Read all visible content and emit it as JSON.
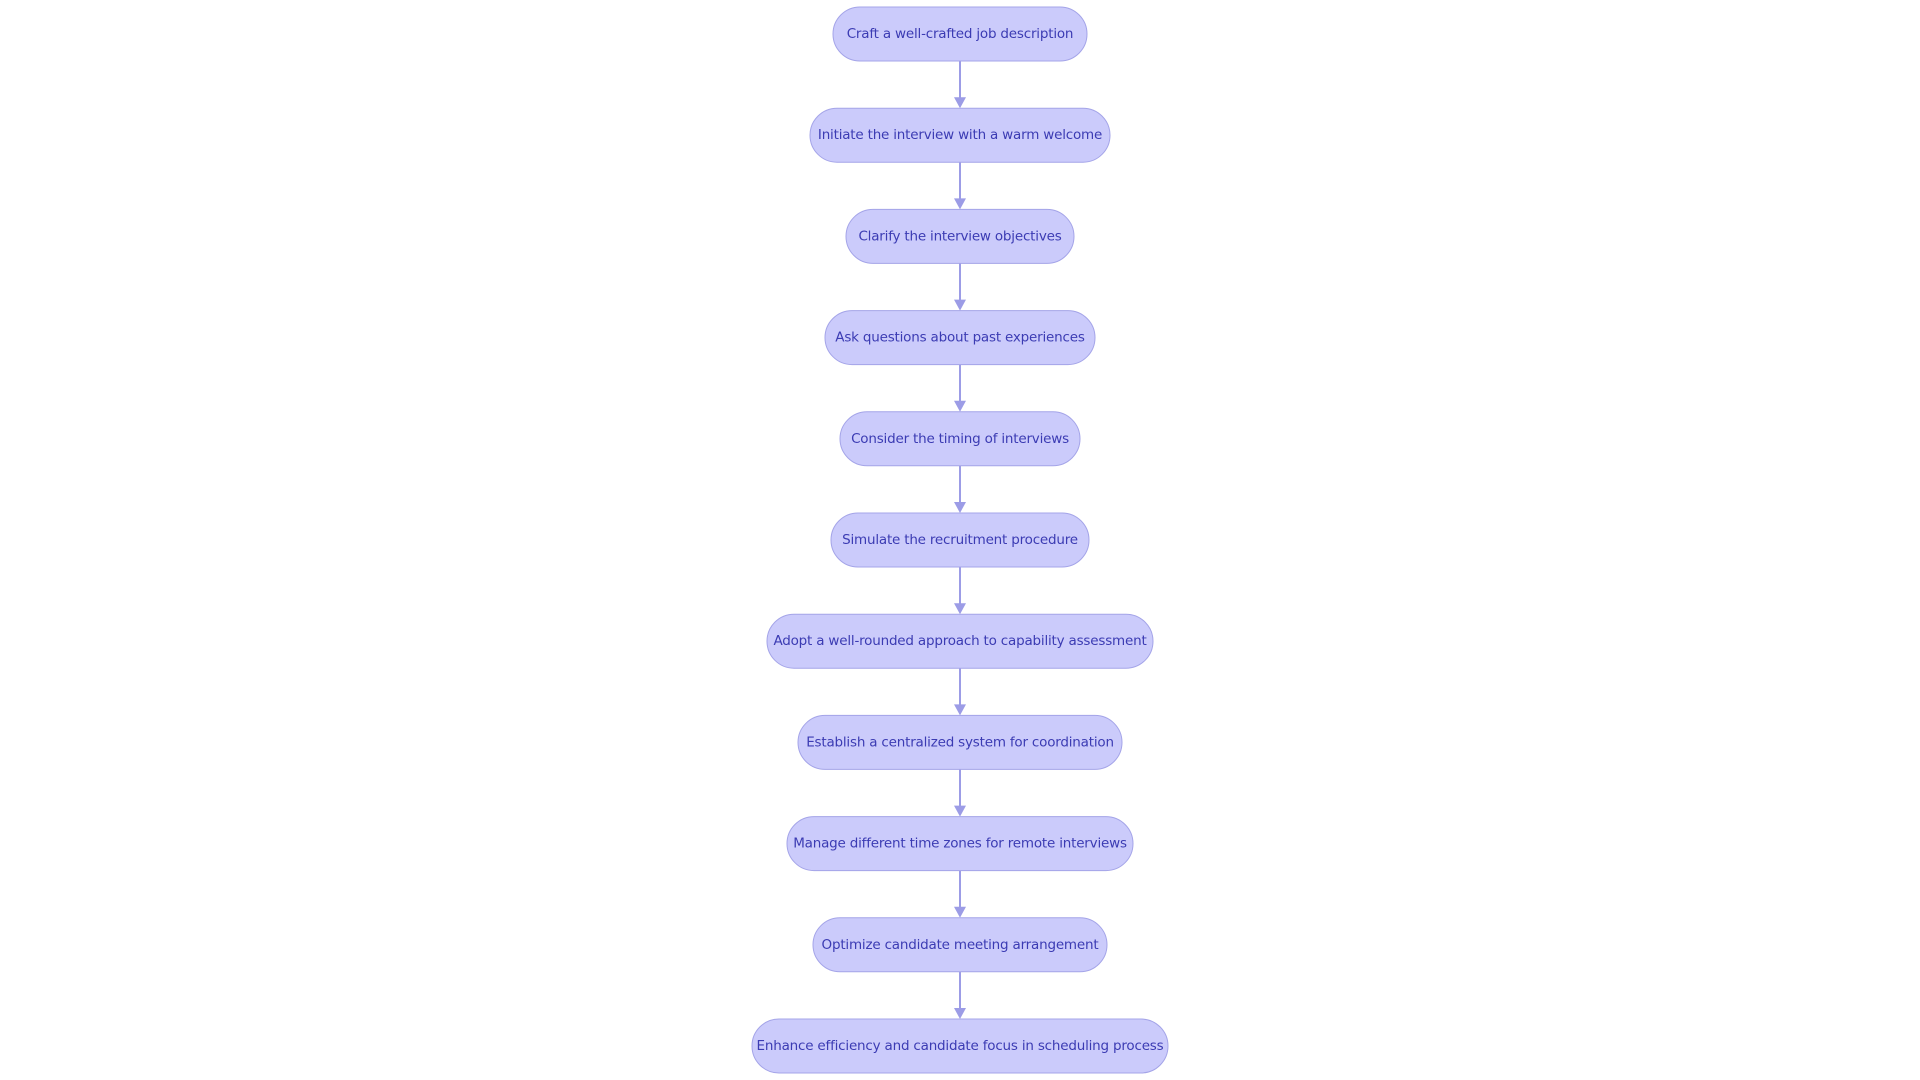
{
  "diagram": {
    "type": "flowchart",
    "direction": "top-to-bottom",
    "colors": {
      "node_fill": "#cbcbfb",
      "node_stroke": "#a4a4e8",
      "node_text": "#3b3bb3",
      "edge": "#9c9ce6"
    },
    "nodes": [
      {
        "id": "n1",
        "label": "Craft a well-crafted job description"
      },
      {
        "id": "n2",
        "label": "Initiate the interview with a warm welcome"
      },
      {
        "id": "n3",
        "label": "Clarify the interview objectives"
      },
      {
        "id": "n4",
        "label": "Ask questions about past experiences"
      },
      {
        "id": "n5",
        "label": "Consider the timing of interviews"
      },
      {
        "id": "n6",
        "label": "Simulate the recruitment procedure"
      },
      {
        "id": "n7",
        "label": "Adopt a well-rounded approach to capability assessment"
      },
      {
        "id": "n8",
        "label": "Establish a centralized system for coordination"
      },
      {
        "id": "n9",
        "label": "Manage different time zones for remote interviews"
      },
      {
        "id": "n10",
        "label": "Optimize candidate meeting arrangement"
      },
      {
        "id": "n11",
        "label": "Enhance efficiency and candidate focus in scheduling process"
      }
    ],
    "edges": [
      {
        "from": "n1",
        "to": "n2"
      },
      {
        "from": "n2",
        "to": "n3"
      },
      {
        "from": "n3",
        "to": "n4"
      },
      {
        "from": "n4",
        "to": "n5"
      },
      {
        "from": "n5",
        "to": "n6"
      },
      {
        "from": "n6",
        "to": "n7"
      },
      {
        "from": "n7",
        "to": "n8"
      },
      {
        "from": "n8",
        "to": "n9"
      },
      {
        "from": "n9",
        "to": "n10"
      },
      {
        "from": "n10",
        "to": "n11"
      }
    ]
  }
}
